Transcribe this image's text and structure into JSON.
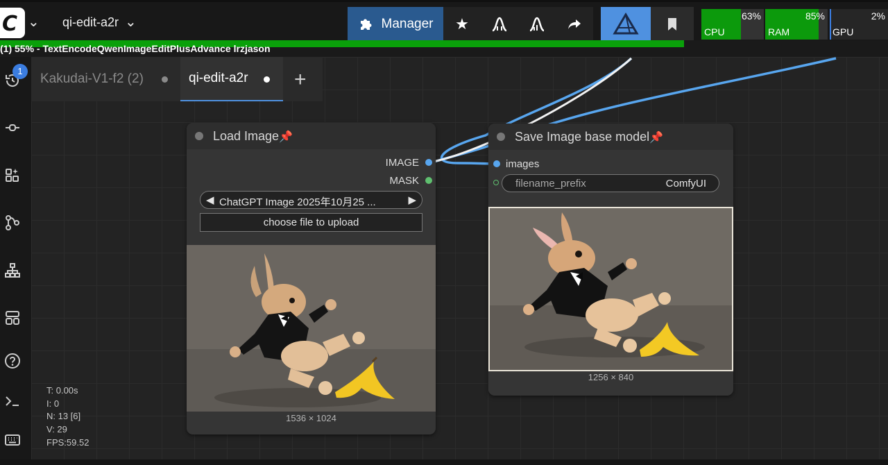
{
  "topbar": {
    "workflow_name": "qi-edit-a2r",
    "manager_label": "Manager",
    "meters": [
      {
        "name": "CPU",
        "percent": "63%",
        "fraction": 0.63
      },
      {
        "name": "RAM",
        "percent": "85%",
        "fraction": 0.85
      },
      {
        "name": "GPU",
        "percent": "2%",
        "fraction": 0.02
      }
    ]
  },
  "progress": {
    "text": "(1) 55% - TextEncodeQwenImageEditPlusAdvance lrzjason",
    "fraction": 0.77
  },
  "sidebar": {
    "queue_badge": "1"
  },
  "tabs": [
    {
      "label": "Kakudai-V1-f2 (2)"
    },
    {
      "label": "qi-edit-a2r"
    }
  ],
  "tab_add": "+",
  "load_image": {
    "title": "Load Image",
    "outputs": [
      "IMAGE",
      "MASK"
    ],
    "file_value": "ChatGPT Image 2025年10月25 ...",
    "upload_label": "choose file to upload",
    "dims": "1536 × 1024"
  },
  "save_image": {
    "title": "Save Image base model",
    "input_label": "images",
    "widget_name": "filename_prefix",
    "widget_value": "ComfyUI",
    "dims": "1256 × 840"
  },
  "stats": {
    "t": "T: 0.00s",
    "i": "I: 0",
    "n": "N: 13 [6]",
    "v": "V: 29",
    "fps": "FPS:59.52"
  },
  "colors": {
    "manager_bg": "#2a5a8f",
    "active_btn_bg": "#4f91e0",
    "meter_fill": "#0c9a0c",
    "pin": "#e0305a",
    "image_slot": "#58a6ef",
    "mask_slot": "#5fbf6f"
  }
}
